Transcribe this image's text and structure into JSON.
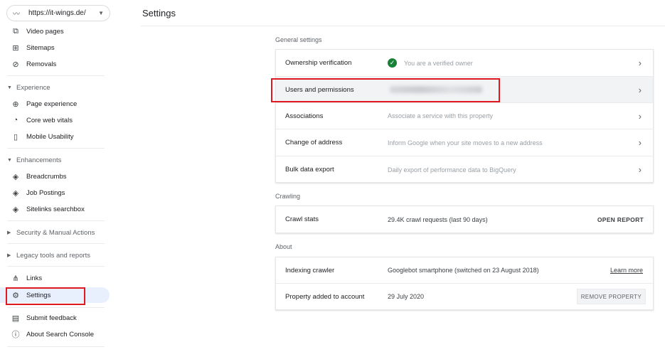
{
  "sidebar": {
    "property_url": "https://it-wings.de/",
    "items_top": [
      {
        "label": "Video pages",
        "icon": "video-page-icon"
      },
      {
        "label": "Sitemaps",
        "icon": "sitemap-icon"
      },
      {
        "label": "Removals",
        "icon": "eye-off-icon"
      }
    ],
    "experience": {
      "heading": "Experience",
      "items": [
        {
          "label": "Page experience",
          "icon": "plus-circle-icon"
        },
        {
          "label": "Core web vitals",
          "icon": "speedometer-icon"
        },
        {
          "label": "Mobile Usability",
          "icon": "phone-icon"
        }
      ]
    },
    "enhancements": {
      "heading": "Enhancements",
      "items": [
        {
          "label": "Breadcrumbs",
          "icon": "layers-icon"
        },
        {
          "label": "Job Postings",
          "icon": "layers-icon"
        },
        {
          "label": "Sitelinks searchbox",
          "icon": "layers-icon"
        }
      ]
    },
    "security_heading": "Security & Manual Actions",
    "legacy_heading": "Legacy tools and reports",
    "links_label": "Links",
    "settings_label": "Settings",
    "feedback_label": "Submit feedback",
    "about_label": "About Search Console"
  },
  "main": {
    "title": "Settings",
    "general": {
      "heading": "General settings",
      "rows": [
        {
          "name": "Ownership verification",
          "desc": "You are a verified owner"
        },
        {
          "name": "Users and permissions",
          "desc": ""
        },
        {
          "name": "Associations",
          "desc": "Associate a service with this property"
        },
        {
          "name": "Change of address",
          "desc": "Inform Google when your site moves to a new address"
        },
        {
          "name": "Bulk data export",
          "desc": "Daily export of performance data to BigQuery"
        }
      ]
    },
    "crawling": {
      "heading": "Crawling",
      "name": "Crawl stats",
      "desc": "29.4K crawl requests (last 90 days)",
      "action": "OPEN REPORT"
    },
    "about": {
      "heading": "About",
      "crawler_name": "Indexing crawler",
      "crawler_desc": "Googlebot smartphone (switched on 23 August 2018)",
      "crawler_link": "Learn more",
      "added_name": "Property added to account",
      "added_desc": "29 July 2020",
      "added_action": "REMOVE PROPERTY"
    }
  },
  "colors": {
    "highlight": "#e0181f",
    "verified": "#188038",
    "active_bg": "#e8f0fe"
  }
}
